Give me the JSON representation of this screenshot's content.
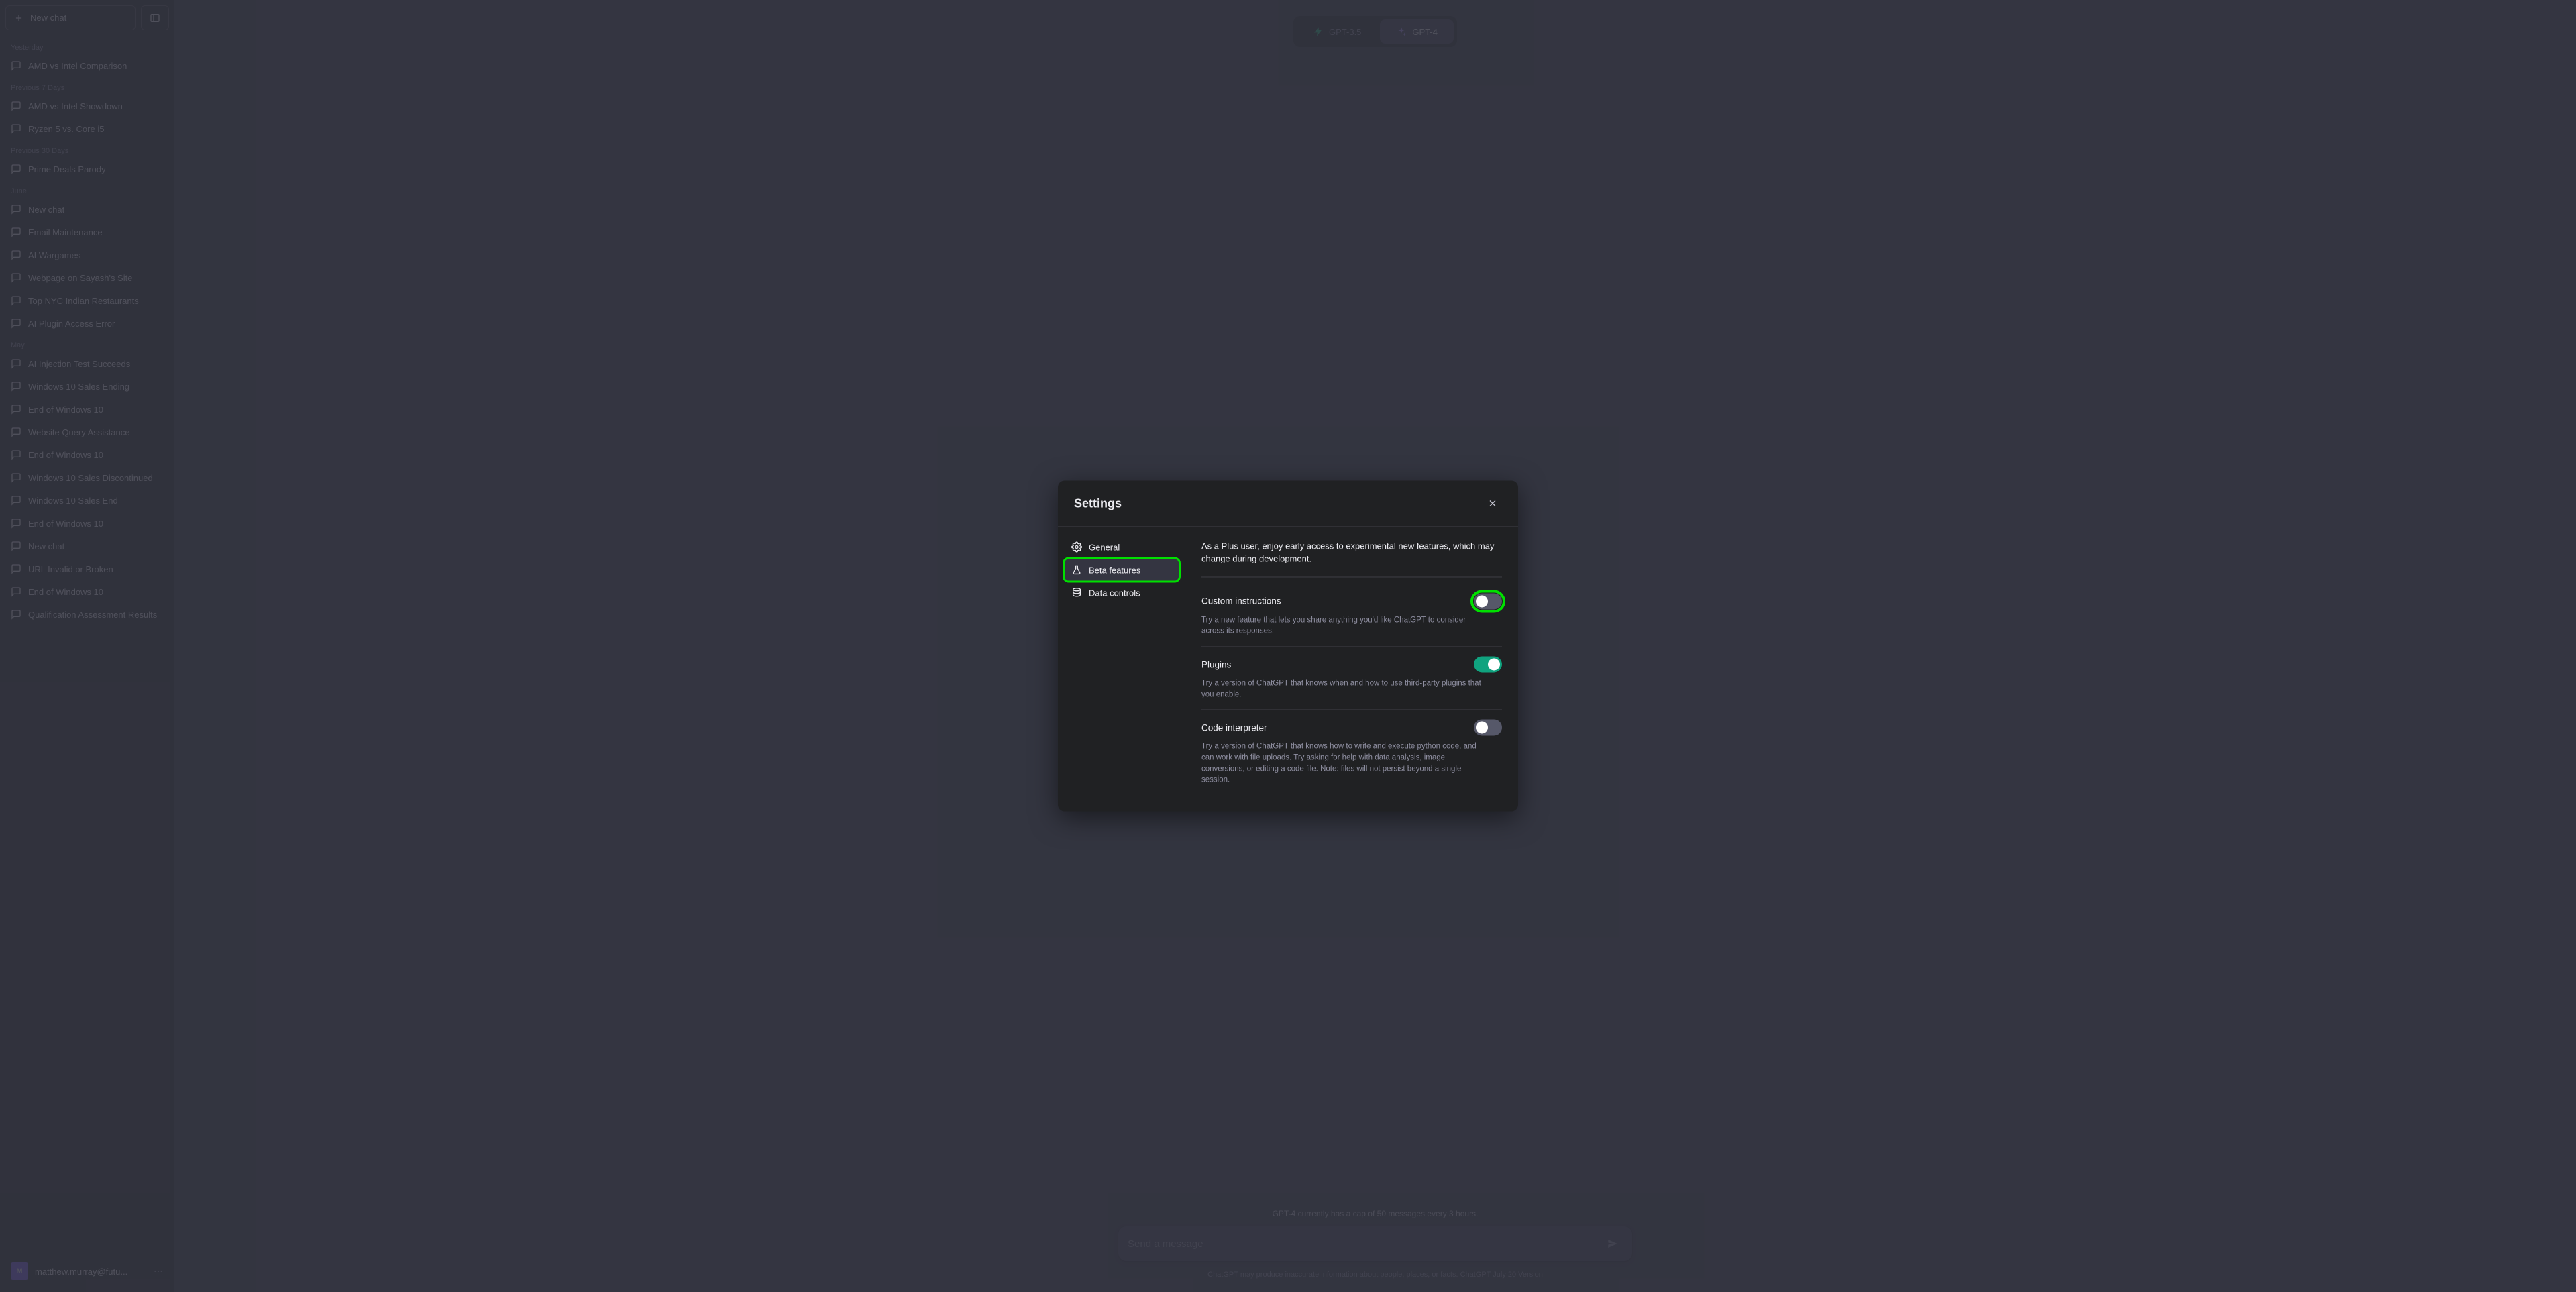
{
  "sidebar": {
    "new_chat_label": "New chat",
    "sections": [
      {
        "header": "Yesterday",
        "items": [
          "AMD vs Intel Comparison"
        ]
      },
      {
        "header": "Previous 7 Days",
        "items": [
          "AMD vs Intel Showdown",
          "Ryzen 5 vs. Core i5"
        ]
      },
      {
        "header": "Previous 30 Days",
        "items": [
          "Prime Deals Parody"
        ]
      },
      {
        "header": "June",
        "items": [
          "New chat",
          "Email Maintenance",
          "AI Wargames",
          "Webpage on Sayash's Site",
          "Top NYC Indian Restaurants",
          "AI Plugin Access Error"
        ]
      },
      {
        "header": "May",
        "items": [
          "AI Injection Test Succeeds",
          "Windows 10 Sales Ending",
          "End of Windows 10",
          "Website Query Assistance",
          "End of Windows 10",
          "Windows 10 Sales Discontinued",
          "Windows 10 Sales End",
          "End of Windows 10",
          "New chat",
          "URL Invalid or Broken",
          "End of Windows 10",
          "Qualification Assessment Results"
        ]
      }
    ],
    "user_email": "matthew.murray@futu...",
    "avatar_initials": "M"
  },
  "header": {
    "models": [
      {
        "label": "GPT-3.5",
        "active": false
      },
      {
        "label": "GPT-4",
        "active": true
      }
    ]
  },
  "input": {
    "cap_note": "GPT-4 currently has a cap of 50 messages every 3 hours.",
    "placeholder": "Send a message",
    "disclaimer": "ChatGPT may produce inaccurate information about people, places, or facts. ChatGPT July 20 Version"
  },
  "modal": {
    "title": "Settings",
    "nav": [
      {
        "icon": "gear",
        "label": "General",
        "active": false,
        "highlight": false
      },
      {
        "icon": "beaker",
        "label": "Beta features",
        "active": true,
        "highlight": true
      },
      {
        "icon": "db",
        "label": "Data controls",
        "active": false,
        "highlight": false
      }
    ],
    "intro": "As a Plus user, enjoy early access to experimental new features, which may change during development.",
    "settings": [
      {
        "label": "Custom instructions",
        "desc": "Try a new feature that lets you share anything you'd like ChatGPT to consider across its responses.",
        "on": false,
        "highlight": true
      },
      {
        "label": "Plugins",
        "desc": "Try a version of ChatGPT that knows when and how to use third-party plugins that you enable.",
        "on": true,
        "highlight": false
      },
      {
        "label": "Code interpreter",
        "desc": "Try a version of ChatGPT that knows how to write and execute python code, and can work with file uploads. Try asking for help with data analysis, image conversions, or editing a code file. Note: files will not persist beyond a single session.",
        "on": false,
        "highlight": false
      }
    ]
  }
}
